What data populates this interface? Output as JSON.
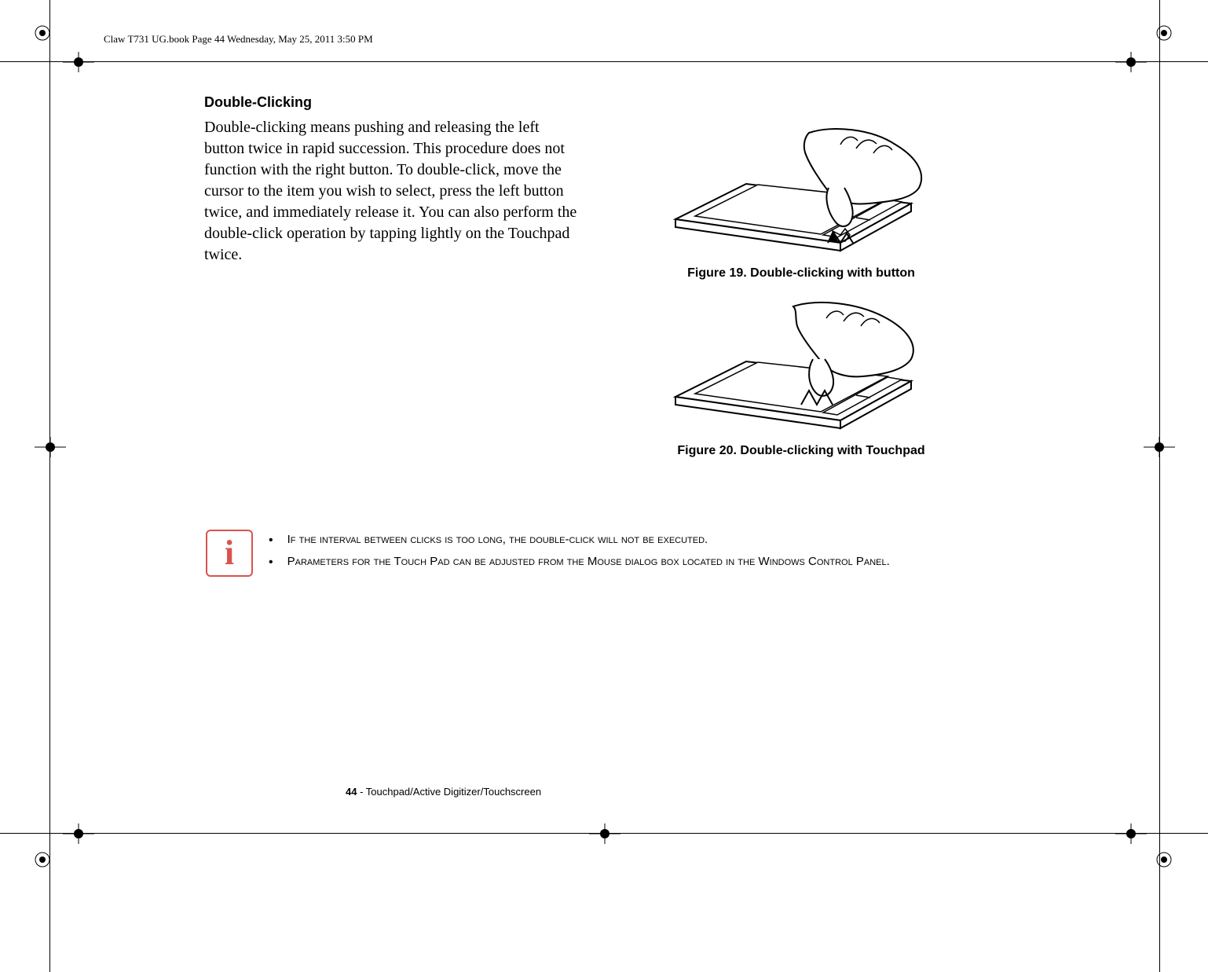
{
  "header": {
    "meta": "Claw T731 UG.book  Page 44  Wednesday, May 25, 2011  3:50 PM"
  },
  "section": {
    "title": "Double-Clicking",
    "body": "Double-clicking means pushing and releasing the left button twice in rapid succession. This procedure does not function with the right button. To double-click, move the cursor to the item you wish to select, press the left button twice, and immediately release it. You can also perform the double-click operation by tapping lightly on the Touchpad twice."
  },
  "figures": {
    "f19_caption": "Figure 19.  Double-clicking with button",
    "f20_caption": "Figure 20.  Double-clicking with Touchpad"
  },
  "info": {
    "icon_label": "i",
    "bullet1": "If the interval between clicks is too long, the double-click will not be executed.",
    "bullet2": "Parameters for the Touch Pad can be adjusted from the Mouse dialog box located in the Windows Control Panel."
  },
  "footer": {
    "page_num": "44",
    "section_path": " - Touchpad/Active Digitizer/Touchscreen"
  }
}
